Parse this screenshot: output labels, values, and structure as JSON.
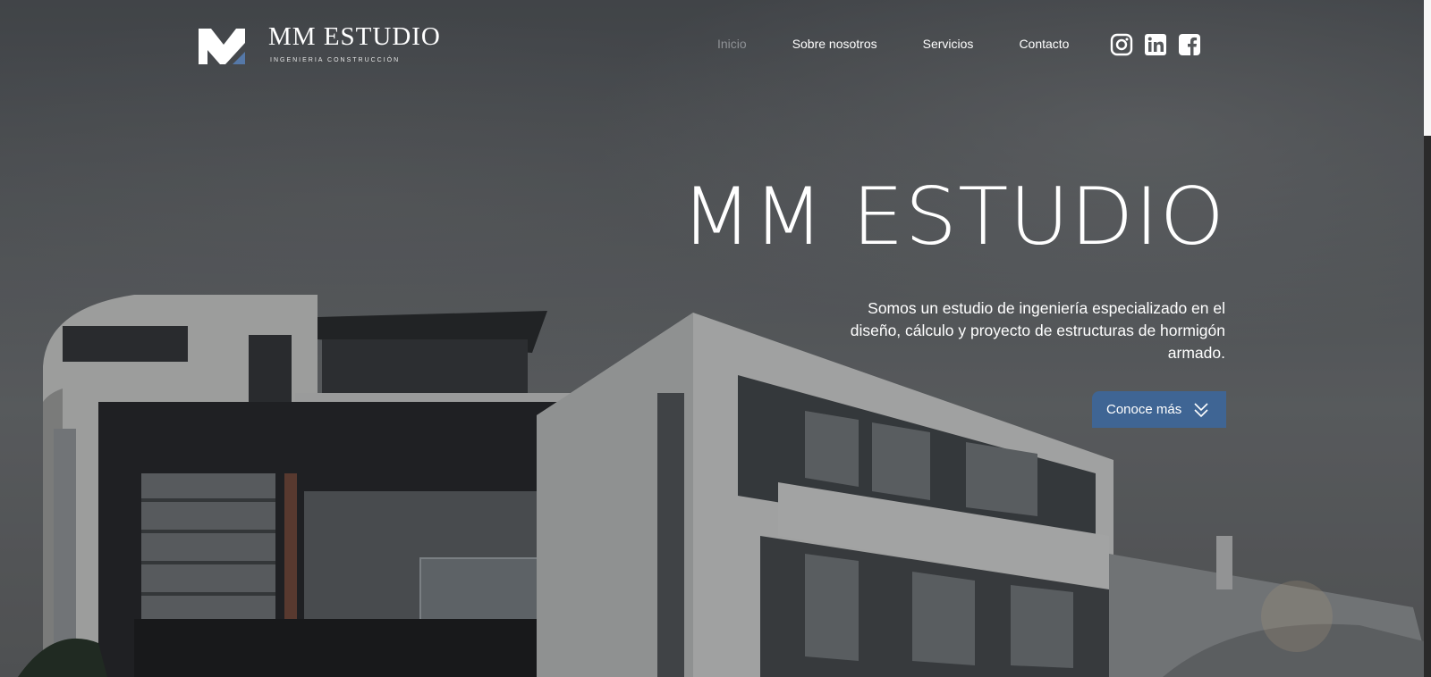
{
  "brand": {
    "name": "MM ESTUDIO",
    "tagline": "INGENIERIA CONSTRUCCIÓN",
    "logo_icon": "mm-logo-icon",
    "accent_color": "#3f6594"
  },
  "nav": {
    "items": [
      {
        "label": "Inicio",
        "active": true
      },
      {
        "label": "Sobre nosotros",
        "active": false
      },
      {
        "label": "Servicios",
        "active": false
      },
      {
        "label": "Contacto",
        "active": false
      }
    ]
  },
  "social": [
    {
      "icon": "instagram-icon"
    },
    {
      "icon": "linkedin-icon"
    },
    {
      "icon": "facebook-icon"
    }
  ],
  "hero": {
    "title": "MM ESTUDIO",
    "description": "Somos un estudio de ingeniería especializado en el diseño, cálculo y proyecto de estructuras de hormigón armado.",
    "cta_label": "Conoce más",
    "cta_icon": "double-chevron-down-icon"
  }
}
